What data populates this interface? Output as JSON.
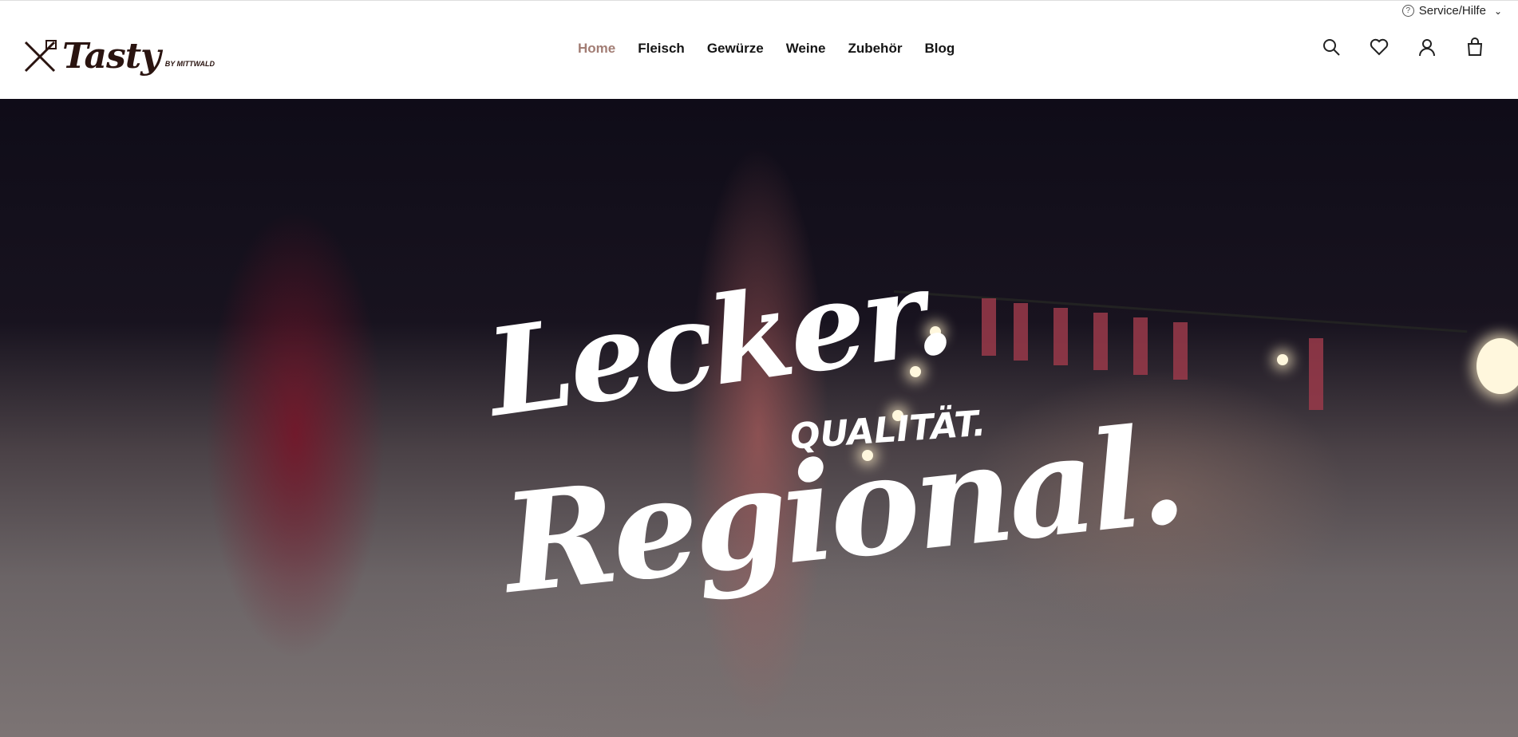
{
  "header": {
    "service_label": "Service/Hilfe",
    "logo": {
      "wordmark": "Tasty",
      "sub": "BY MITTWALD"
    },
    "nav": [
      {
        "label": "Home",
        "active": true
      },
      {
        "label": "Fleisch"
      },
      {
        "label": "Gewürze"
      },
      {
        "label": "Weine"
      },
      {
        "label": "Zubehör"
      },
      {
        "label": "Blog"
      }
    ],
    "icons": [
      "search-icon",
      "heart-icon",
      "account-icon",
      "cart-icon"
    ]
  },
  "hero": {
    "line1": "Lecker.",
    "line2": "QUALITÄT.",
    "line3": "Regional."
  },
  "colors": {
    "nav_active": "#a27d74",
    "logo": "#2a1410"
  }
}
